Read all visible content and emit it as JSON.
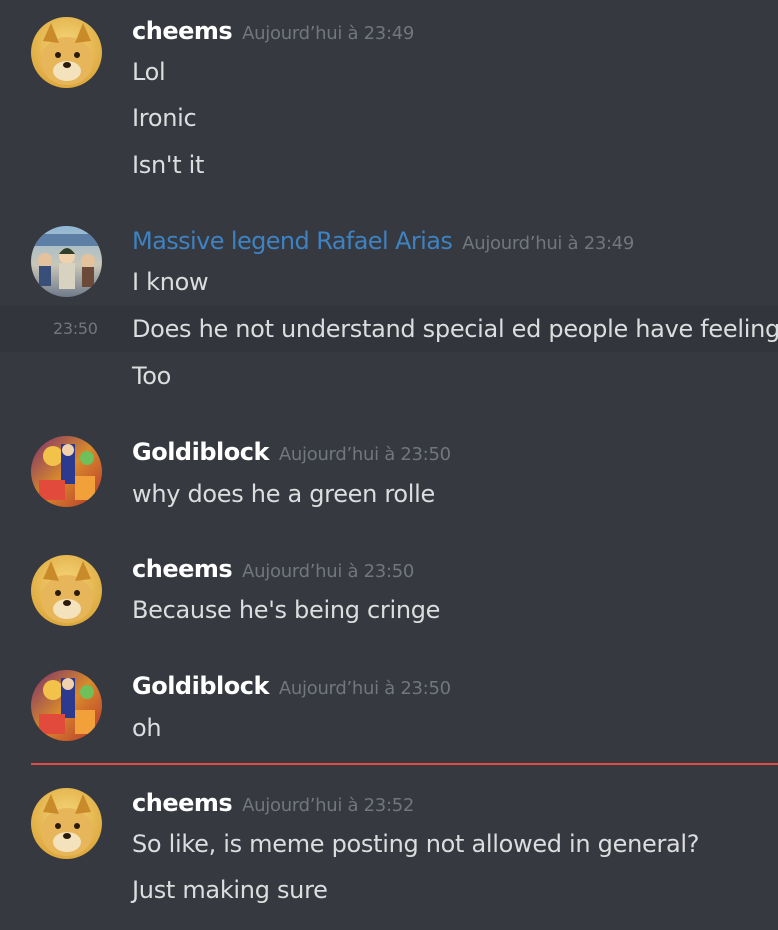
{
  "messages": [
    {
      "author": "cheems",
      "avatar": "cheems-doge",
      "timestamp": "Aujourd’hui à 23:49",
      "lines": [
        "Lol",
        "Ironic",
        "Isn't it"
      ]
    },
    {
      "author": "Massive legend Rafael Arias",
      "avatar": "anime-crowd",
      "author_color": "#3e82c2",
      "timestamp": "Aujourd’hui à 23:49",
      "lines": [
        "I know"
      ],
      "hovered_line": {
        "time": "23:50",
        "text": "Does he not understand special ed people have feelings"
      },
      "extra_lines": [
        "Too"
      ]
    },
    {
      "author": "Goldiblock",
      "avatar": "colorful-art",
      "timestamp": "Aujourd’hui à 23:50",
      "lines": [
        "why does he a green rolle"
      ]
    },
    {
      "author": "cheems",
      "avatar": "cheems-doge",
      "timestamp": "Aujourd’hui à 23:50",
      "lines": [
        "Because he's being cringe"
      ]
    },
    {
      "author": "Goldiblock",
      "avatar": "colorful-art",
      "timestamp": "Aujourd’hui à 23:50",
      "lines": [
        "oh"
      ]
    },
    {
      "author": "cheems",
      "avatar": "cheems-doge",
      "timestamp": "Aujourd’hui à 23:52",
      "lines": [
        "So like, is meme posting not allowed in general?",
        "Just making sure"
      ]
    }
  ],
  "colors": {
    "background": "#36393f",
    "hover_background": "#32353b",
    "username": "#ffffff",
    "timestamp": "#72767d",
    "message_text": "#dcddde",
    "new_messages_divider": "#e04b46"
  }
}
